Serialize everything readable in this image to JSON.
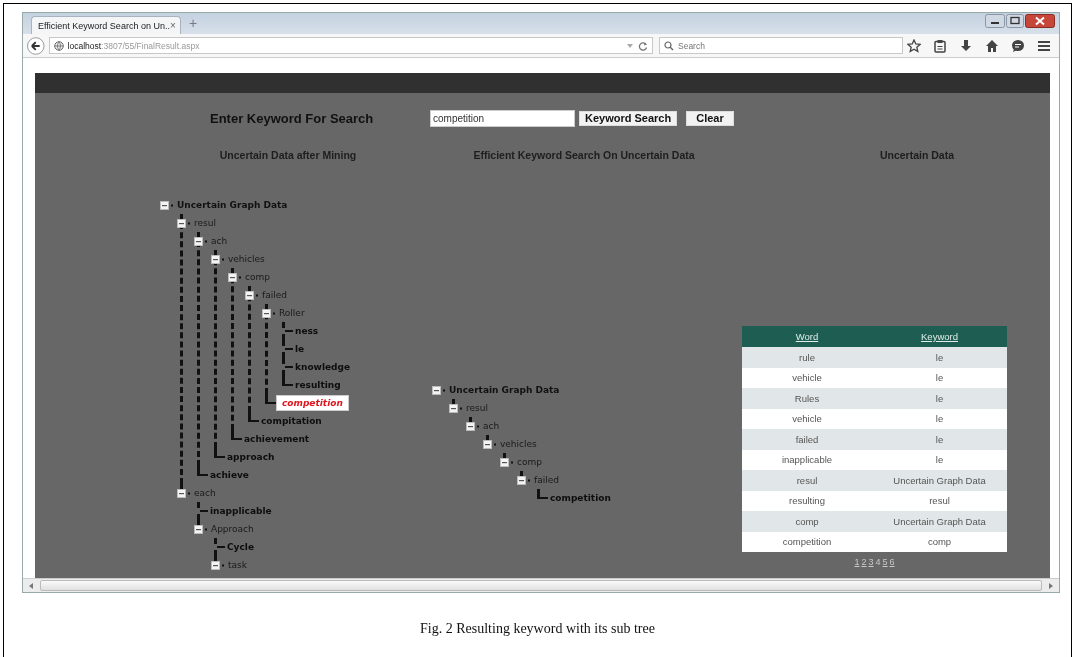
{
  "browser": {
    "tab": {
      "title": "Efficient Keyword Search on Un..",
      "close": "×"
    },
    "new_tab": "+",
    "address": "**localhost**:3807/55/FinalResult.aspx",
    "search_placeholder": "Search"
  },
  "search_bar": {
    "label": "Enter Keyword For Search",
    "field": {
      "value": "competition"
    },
    "buttons": [
      "Keyword Search",
      "Clear"
    ]
  },
  "panels": [
    {
      "heading": "Uncertain Data after Mining",
      "tree": {
        "label": "Uncertain Graph Data",
        "expanded": true,
        "selected": false,
        "children": [
          {
            "label": "resul",
            "expanded": true,
            "selected": false,
            "children": [
              {
                "label": "ach",
                "expanded": true,
                "selected": false,
                "children": [
                  {
                    "label": "vehicles",
                    "expanded": true,
                    "selected": false,
                    "children": [
                      {
                        "label": "comp",
                        "expanded": true,
                        "selected": false,
                        "children": [
                          {
                            "label": "failed",
                            "expanded": true,
                            "selected": false,
                            "children": [
                              {
                                "label": "Roller",
                                "expanded": true,
                                "selected": false,
                                "children": [
                                  {
                                    "label": "ness",
                                    "selected": false
                                  },
                                  {
                                    "label": "le",
                                    "selected": false
                                  },
                                  {
                                    "label": "knowledge",
                                    "selected": false
                                  },
                                  {
                                    "label": "resulting",
                                    "selected": false
                                  }
                                ]
                              },
                              {
                                "label": "competition",
                                "selected": true
                              }
                            ]
                          },
                          {
                            "label": "compitation",
                            "selected": false
                          }
                        ]
                      },
                      {
                        "label": "achievement",
                        "selected": false
                      }
                    ]
                  },
                  {
                    "label": "approach",
                    "selected": false
                  }
                ]
              },
              {
                "label": "achieve",
                "selected": false
              }
            ]
          },
          {
            "label": "each",
            "expanded": true,
            "selected": false,
            "children": [
              {
                "label": "inapplicable",
                "selected": false
              },
              {
                "label": "Approach",
                "expanded": true,
                "selected": false,
                "children": [
                  {
                    "label": "Cycle",
                    "selected": false
                  },
                  {
                    "label": "task",
                    "expanded": true,
                    "selected": false
                  }
                ]
              }
            ]
          }
        ]
      }
    },
    {
      "heading": "Efficient Keyword Search On Uncertain Data",
      "tree": {
        "label": "Uncertain Graph Data",
        "expanded": true,
        "selected": false,
        "children": [
          {
            "label": "resul",
            "expanded": true,
            "selected": false,
            "children": [
              {
                "label": "ach",
                "expanded": true,
                "selected": false,
                "children": [
                  {
                    "label": "vehicles",
                    "expanded": true,
                    "selected": false,
                    "children": [
                      {
                        "label": "comp",
                        "expanded": true,
                        "selected": false,
                        "children": [
                          {
                            "label": "failed",
                            "expanded": true,
                            "selected": false,
                            "children": [
                              {
                                "label": "competition",
                                "selected": false
                              }
                            ]
                          }
                        ]
                      }
                    ]
                  }
                ]
              }
            ]
          }
        ]
      }
    },
    {
      "heading": "Uncertain Data",
      "table": {
        "columns": [
          "Word",
          "Keyword"
        ],
        "rows": [
          [
            "rule",
            "le"
          ],
          [
            "vehicle",
            "le"
          ],
          [
            "Rules",
            "le"
          ],
          [
            "vehicle",
            "le"
          ],
          [
            "failed",
            "le"
          ],
          [
            "inapplicable",
            "le"
          ],
          [
            "resul",
            "Uncertain Graph Data"
          ],
          [
            "resulting",
            "resul"
          ],
          [
            "comp",
            "Uncertain Graph Data"
          ],
          [
            "competition",
            "comp"
          ]
        ]
      },
      "pager": [
        {
          "label": "1",
          "selected": false
        },
        {
          "label": "2",
          "selected": false
        },
        {
          "label": "3",
          "selected": false
        },
        {
          "label": "4",
          "selected": true
        },
        {
          "label": "5",
          "selected": false
        },
        {
          "label": "6",
          "selected": false
        }
      ]
    }
  ],
  "caption": "Fig. 2 Resulting keyword with its sub tree"
}
